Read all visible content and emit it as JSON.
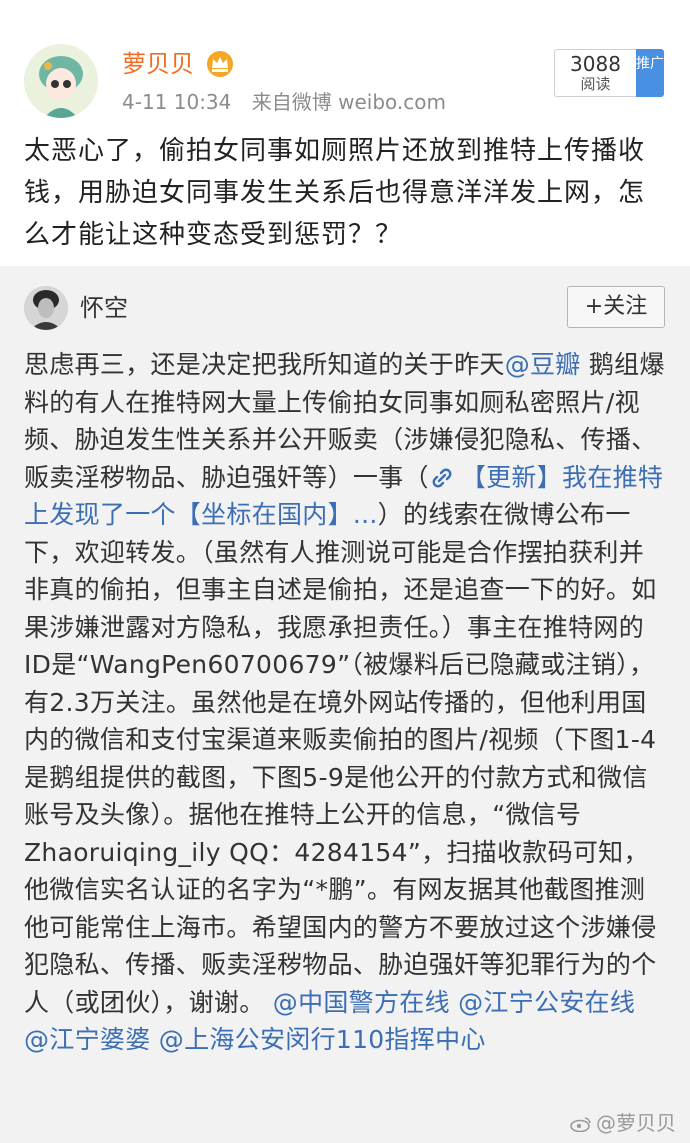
{
  "post": {
    "username": "萝贝贝",
    "time": "4-11 10:34",
    "source": "来自微博 weibo.com",
    "read_count": "3088",
    "read_label": "阅读",
    "promo_tag": "推广",
    "text": "太恶心了，偷拍女同事如厕照片还放到推特上传播收钱，用胁迫女同事发生关系后也得意洋洋发上网，怎么才能让这种变态受到惩罚？？"
  },
  "repost": {
    "username": "怀空",
    "follow_label": "+关注",
    "t1": "思虑再三，还是决定把我所知道的关于昨天",
    "mention_douban": "@豆瓣",
    "t2": " 鹅组爆料的有人在推特网大量上传偷拍女同事如厕私密照片/视频、胁迫发生性关系并公开贩卖（涉嫌侵犯隐私、传播、贩卖淫秽物品、胁迫强奸等）一事（",
    "link_text": "【更新】我在推特上发现了一个【坐标在国内】...",
    "t3": "）的线索在微博公布一下，欢迎转发。（虽然有人推测说可能是合作摆拍获利并非真的偷拍，但事主自述是偷拍，还是追查一下的好。如果涉嫌泄露对方隐私，我愿承担责任。）事主在推特网的ID是“WangPen60700679”（被爆料后已隐藏或注销），有2.3万关注。虽然他是在境外网站传播的，但他利用国内的微信和支付宝渠道来贩卖偷拍的图片/视频（下图1-4是鹅组提供的截图，下图5-9是他公开的付款方式和微信账号及头像）。据他在推特上公开的信息，“微信号Zhaoruiqing_ily QQ：4284154”，扫描收款码可知，他微信实名认证的名字为“*鹏”。有网友据其他截图推测他可能常住上海市。希望国内的警方不要放过这个涉嫌侵犯隐私、传播、贩卖淫秽物品、胁迫强奸等犯罪行为的个人（或团伙），谢谢。",
    "mention_1": "@中国警方在线",
    "mention_2": "@江宁公安在线",
    "mention_3": "@江宁婆婆",
    "mention_4": "@上海公安闵行110指挥中心"
  },
  "watermark": "@萝贝贝",
  "colors": {
    "username": "#f26d21",
    "link": "#3c6eb4",
    "promo": "#4a90e2",
    "repost_bg": "#f2f2f2"
  },
  "icons": [
    "crown-icon",
    "link-icon",
    "weibo-logo-icon"
  ]
}
